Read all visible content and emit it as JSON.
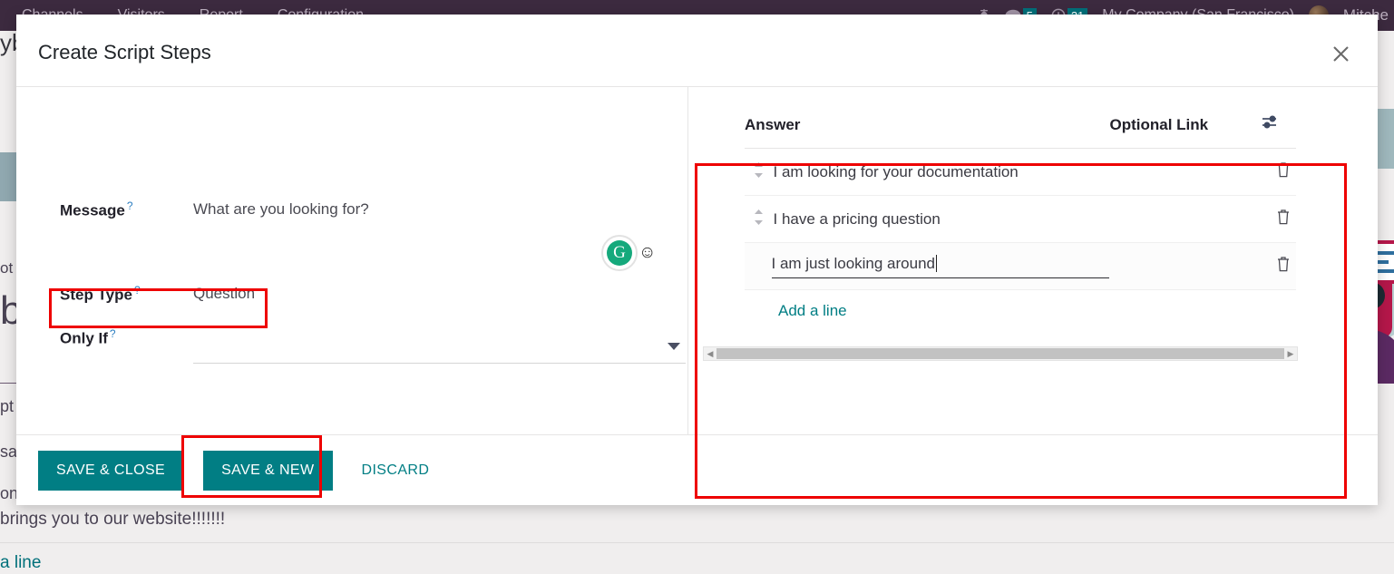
{
  "navbar": {
    "menu_items": [
      {
        "label": "Channels"
      },
      {
        "label": "Visitors"
      },
      {
        "label": "Report"
      },
      {
        "label": "Configuration"
      }
    ],
    "bug_icon": "bug-icon",
    "messages_icon": "chat-bubble-icon",
    "messages_count": "5",
    "activities_icon": "clock-icon",
    "activities_count": "21",
    "company": "My Company (San Francisco)",
    "avatar": "user-avatar",
    "user": "Mitche"
  },
  "background": {
    "fragment_top_left": "yb",
    "fragment_ot": "ot",
    "fragment_b": "b",
    "fragment_pt": "pt",
    "fragment_sag": "sag",
    "fragment_on": "on",
    "line_text": "brings you to our website!!!!!!!",
    "add_line": "a line"
  },
  "modal": {
    "title": "Create Script Steps",
    "close_icon": "close-icon"
  },
  "form": {
    "message": {
      "label": "Message",
      "tip": "?",
      "value": "What are you looking for?"
    },
    "step_type": {
      "label": "Step Type",
      "tip": "?",
      "value": "Question"
    },
    "only_if": {
      "label": "Only If",
      "tip": "?",
      "value": "",
      "dropdown_icon": "chevron-down-icon"
    },
    "grammarly_icon": "grammarly-icon",
    "grammarly_letter": "G",
    "emoji_icon": "smiley-icon",
    "emoji_glyph": "☺"
  },
  "answers": {
    "columns": {
      "answer": "Answer",
      "optional_link": "Optional Link",
      "options_icon": "column-settings-icon"
    },
    "rows": [
      {
        "handle_icon": "drag-handle-icon",
        "answer": "I am looking for your documentation",
        "optional_link": "",
        "delete_icon": "trash-icon",
        "editing": false
      },
      {
        "handle_icon": "drag-handle-icon",
        "answer": "I have a pricing question",
        "optional_link": "",
        "delete_icon": "trash-icon",
        "editing": false
      },
      {
        "handle_icon": "",
        "answer": "I am just looking around",
        "optional_link": "",
        "delete_icon": "trash-icon",
        "editing": true
      }
    ],
    "add_line": "Add a line",
    "scrollbar": {
      "left_arrow": "scroll-left-icon",
      "right_arrow": "scroll-right-icon"
    }
  },
  "footer": {
    "save_close": "SAVE & CLOSE",
    "save_new": "SAVE & NEW",
    "discard": "DISCARD"
  },
  "colors": {
    "accent_teal": "#017e84",
    "navbar_purple": "#3c2a3f",
    "annotation_red": "#ee0000",
    "grammarly_green": "#15a97c"
  }
}
